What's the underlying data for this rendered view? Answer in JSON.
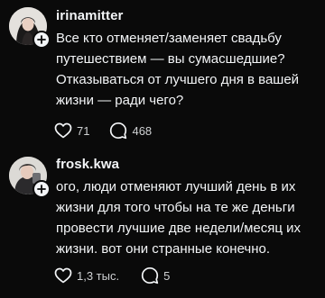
{
  "posts": [
    {
      "username": "irinamitter",
      "text": "Все кто отменяет/заменяет свадьбу путешествием — вы сумасшедшие? Отказываться от лучшего дня в вашей жизни — ради чего?",
      "likes": "71",
      "replies": "468",
      "avatar_icon": "profile-photo"
    },
    {
      "username": "frosk.kwa",
      "text": "ого, люди отменяют лучший день в их жизни для того чтобы на те же деньги провести лучшие две недели/месяц их жизни. вот они странные конечно.",
      "likes": "1,3 тыс.",
      "replies": "5",
      "avatar_icon": "profile-photo"
    }
  ],
  "colors": {
    "background": "#0a0a0a",
    "text": "#f3f5f7",
    "secondary_text": "#cfd1d3"
  },
  "icons": {
    "like": "heart-icon",
    "reply": "speech-bubble-icon",
    "follow": "plus-icon"
  }
}
